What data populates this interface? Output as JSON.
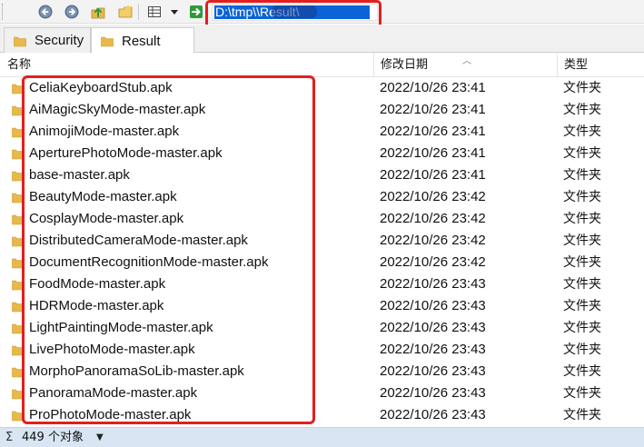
{
  "toolbar": {
    "address_text": "D:\\tmp\\\\Result\\",
    "back_icon": "back-arrow-icon",
    "forward_icon": "forward-arrow-icon",
    "up_icon": "up-folder-icon",
    "new_folder_icon": "new-folder-icon",
    "view_icon": "view-mode-icon",
    "go_icon": "go-arrow-icon"
  },
  "tabs": [
    {
      "label": "Security",
      "active": false
    },
    {
      "label": "Result",
      "active": true
    }
  ],
  "columns": {
    "name": "名称",
    "date": "修改日期",
    "type": "类型"
  },
  "files": [
    {
      "name": "CeliaKeyboardStub.apk",
      "date": "2022/10/26 23:41",
      "type": "文件夹"
    },
    {
      "name": "AiMagicSkyMode-master.apk",
      "date": "2022/10/26 23:41",
      "type": "文件夹"
    },
    {
      "name": "AnimojiMode-master.apk",
      "date": "2022/10/26 23:41",
      "type": "文件夹"
    },
    {
      "name": "AperturePhotoMode-master.apk",
      "date": "2022/10/26 23:41",
      "type": "文件夹"
    },
    {
      "name": "base-master.apk",
      "date": "2022/10/26 23:41",
      "type": "文件夹"
    },
    {
      "name": "BeautyMode-master.apk",
      "date": "2022/10/26 23:42",
      "type": "文件夹"
    },
    {
      "name": "CosplayMode-master.apk",
      "date": "2022/10/26 23:42",
      "type": "文件夹"
    },
    {
      "name": "DistributedCameraMode-master.apk",
      "date": "2022/10/26 23:42",
      "type": "文件夹"
    },
    {
      "name": "DocumentRecognitionMode-master.apk",
      "date": "2022/10/26 23:42",
      "type": "文件夹"
    },
    {
      "name": "FoodMode-master.apk",
      "date": "2022/10/26 23:43",
      "type": "文件夹"
    },
    {
      "name": "HDRMode-master.apk",
      "date": "2022/10/26 23:43",
      "type": "文件夹"
    },
    {
      "name": "LightPaintingMode-master.apk",
      "date": "2022/10/26 23:43",
      "type": "文件夹"
    },
    {
      "name": "LivePhotoMode-master.apk",
      "date": "2022/10/26 23:43",
      "type": "文件夹"
    },
    {
      "name": "MorphoPanoramaSoLib-master.apk",
      "date": "2022/10/26 23:43",
      "type": "文件夹"
    },
    {
      "name": "PanoramaMode-master.apk",
      "date": "2022/10/26 23:43",
      "type": "文件夹"
    },
    {
      "name": "ProPhotoMode-master.apk",
      "date": "2022/10/26 23:43",
      "type": "文件夹"
    }
  ],
  "status": {
    "sigma": "Σ",
    "count_text": "449 个对象"
  },
  "colors": {
    "folder": "#e8b84a",
    "selection": "#0a64d8",
    "annotation": "#e41e1e",
    "status_bg": "#d9e5f3"
  }
}
